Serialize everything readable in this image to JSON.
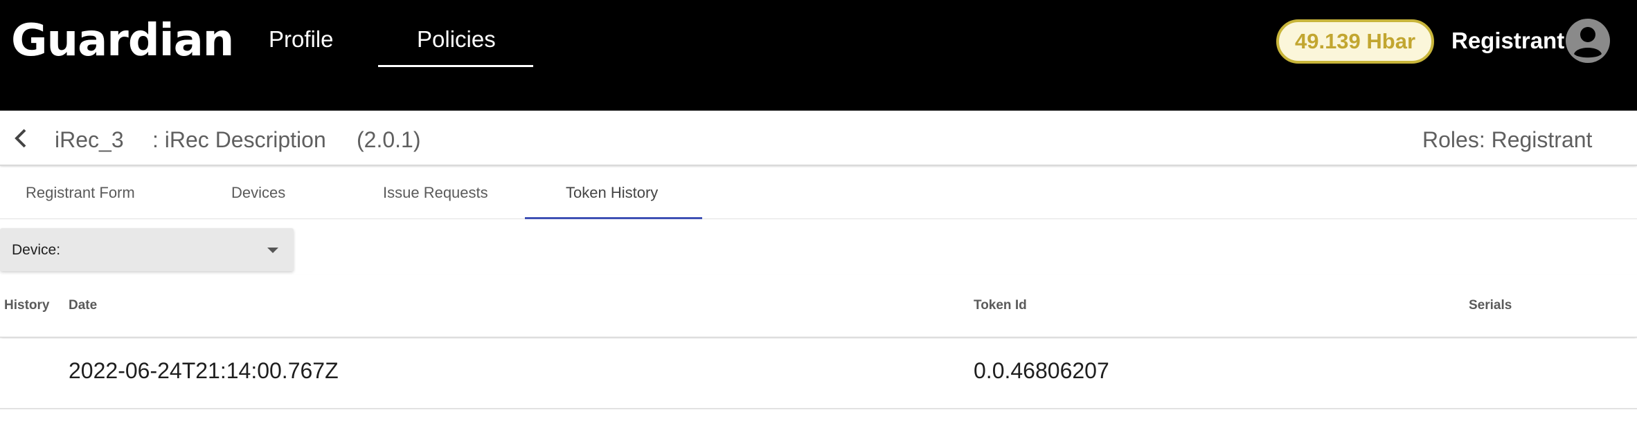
{
  "header": {
    "logo": "Guardian",
    "nav": [
      {
        "label": "Profile"
      },
      {
        "label": "Policies"
      }
    ],
    "balance": "49.139 Hbar",
    "user": "Registrant",
    "avatar_icon": "account-circle-icon"
  },
  "policy": {
    "name": "iRec_3",
    "description": ": iRec Description",
    "version": "(2.0.1)",
    "roles": "Roles: Registrant",
    "back_icon": "chevron-left-icon"
  },
  "tabs": [
    {
      "label": "Registrant Form"
    },
    {
      "label": "Devices"
    },
    {
      "label": "Issue Requests"
    },
    {
      "label": "Token History",
      "active": true
    }
  ],
  "filter": {
    "label": "Device:",
    "icon": "dropdown-arrow-icon"
  },
  "table": {
    "columns": [
      "History",
      "Date",
      "Token Id",
      "Serials"
    ],
    "rows": [
      {
        "history": "",
        "date": "2022-06-24T21:14:00.767Z",
        "token_id": "0.0.46806207",
        "serials": ""
      }
    ]
  },
  "colors": {
    "accent": "#3f51b5",
    "balance_border": "#c8b53a",
    "balance_text": "#c2a630",
    "header_bg": "#000000"
  }
}
